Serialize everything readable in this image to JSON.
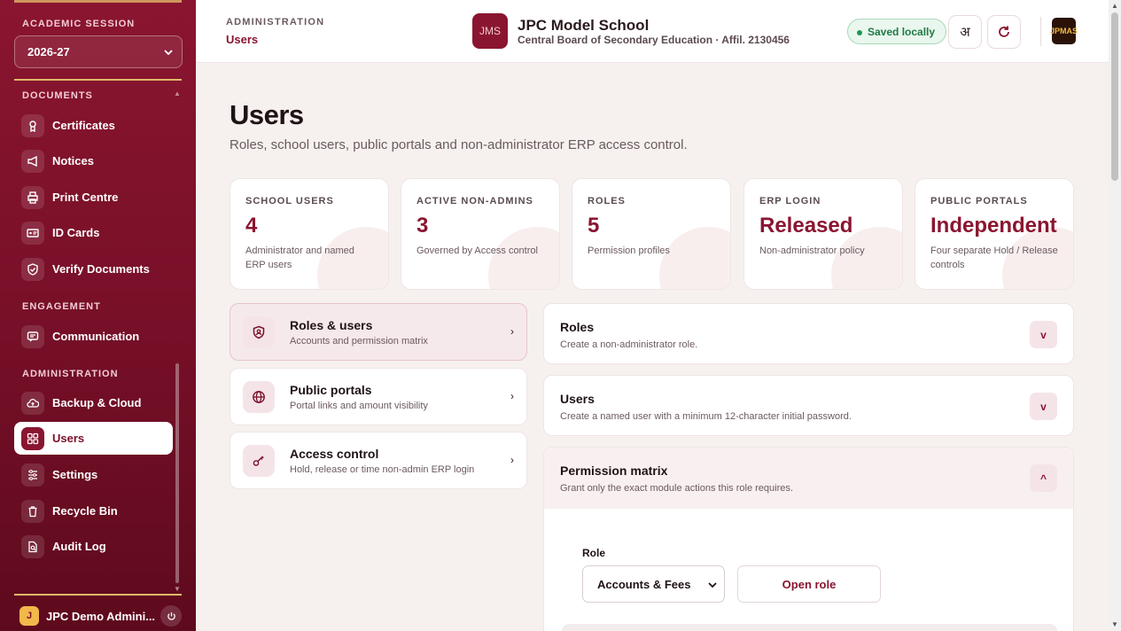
{
  "sidebar": {
    "session_label": "ACADEMIC SESSION",
    "session_value": "2026-27",
    "sections": {
      "documents": "DOCUMENTS",
      "engagement": "ENGAGEMENT",
      "administration": "ADMINISTRATION"
    },
    "items": {
      "certificates": "Certificates",
      "notices": "Notices",
      "print_centre": "Print Centre",
      "id_cards": "ID Cards",
      "verify_documents": "Verify Documents",
      "communication": "Communication",
      "backup_cloud": "Backup & Cloud",
      "users": "Users",
      "settings": "Settings",
      "recycle_bin": "Recycle Bin",
      "audit_log": "Audit Log"
    },
    "user": {
      "initial": "J",
      "name": "JPC Demo Admini..."
    }
  },
  "header": {
    "crumb_label": "ADMINISTRATION",
    "crumb_current": "Users",
    "logo_text": "JMS",
    "school_name": "JPC Model School",
    "school_sub": "Central Board of Secondary Education · Affil. 2130456",
    "saved_label": "Saved locally",
    "lang_glyph": "अ",
    "brand_text": "JPMAS"
  },
  "main": {
    "title": "Users",
    "subtitle": "Roles, school users, public portals and non-administrator ERP access control.",
    "stats": [
      {
        "label": "SCHOOL USERS",
        "value": "4",
        "desc": "Administrator and named ERP users"
      },
      {
        "label": "ACTIVE NON-ADMINS",
        "value": "3",
        "desc": "Governed by Access control"
      },
      {
        "label": "ROLES",
        "value": "5",
        "desc": "Permission profiles"
      },
      {
        "label": "ERP LOGIN",
        "value": "Released",
        "desc": "Non-administrator policy"
      },
      {
        "label": "PUBLIC PORTALS",
        "value": "Independent",
        "desc": "Four separate Hold / Release controls"
      }
    ],
    "menu": [
      {
        "title": "Roles & users",
        "sub": "Accounts and permission matrix"
      },
      {
        "title": "Public portals",
        "sub": "Portal links and amount visibility"
      },
      {
        "title": "Access control",
        "sub": "Hold, release or time non-admin ERP login"
      }
    ],
    "panels": {
      "roles": {
        "title": "Roles",
        "sub": "Create a non-administrator role.",
        "toggle": "v"
      },
      "users": {
        "title": "Users",
        "sub": "Create a named user with a minimum 12-character initial password.",
        "toggle": "v"
      },
      "matrix": {
        "title": "Permission matrix",
        "sub": "Grant only the exact module actions this role requires.",
        "toggle": "^"
      }
    },
    "matrix_form": {
      "role_label": "Role",
      "role_value": "Accounts & Fees",
      "open_role": "Open role"
    }
  },
  "colors": {
    "accent": "#8a1530",
    "saved_green": "#1f7a45"
  }
}
